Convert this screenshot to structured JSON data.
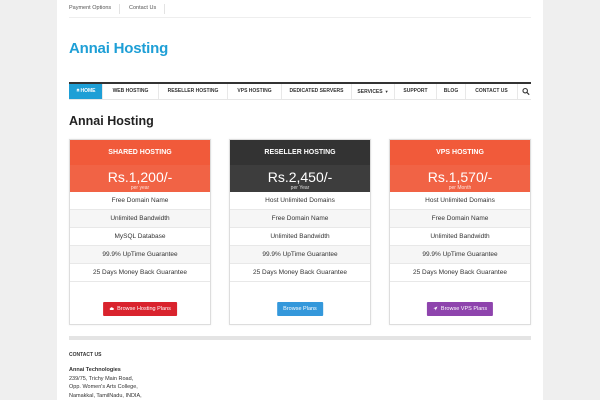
{
  "topbar": {
    "links": [
      "Payment Options",
      "Contact Us"
    ]
  },
  "site": {
    "title": "Annai Hosting"
  },
  "nav": {
    "items": [
      "HOME",
      "WEB HOSTING",
      "RESELLER HOSTING",
      "VPS HOSTING",
      "DEDICATED SERVERS",
      "SERVICES",
      "SUPPORT",
      "BLOG",
      "CONTACT US"
    ],
    "active": "HOME",
    "active_color": "#1e9fd6"
  },
  "page": {
    "title": "Annai Hosting"
  },
  "plans": [
    {
      "name": "SHARED HOSTING",
      "price": "Rs.1,200/-",
      "period": "per year",
      "color": "#f15a3a",
      "features": [
        "Free Domain Name",
        "Unlimited Bandwidth",
        "MySQL Database",
        "99.9% UpTime Guarantee",
        "25 Days Money Back Guarantee"
      ],
      "button": {
        "label": "Browse Hosting Plans",
        "color": "#d9232d",
        "icon": "cloud-icon"
      }
    },
    {
      "name": "RESELLER HOSTING",
      "price": "Rs.2,450/-",
      "period": "per Year",
      "color": "#333333",
      "features": [
        "Host Unlimited Domains",
        "Free Domain Name",
        "Unlimited Bandwidth",
        "99.9% UpTime Guarantee",
        "25 Days Money Back Guarantee"
      ],
      "button": {
        "label": "Browse Plans",
        "color": "#3498db",
        "icon": ""
      }
    },
    {
      "name": "VPS HOSTING",
      "price": "Rs.1,570/-",
      "period": "per Month",
      "color": "#f15a3a",
      "features": [
        "Host Unlimited Domains",
        "Free Domain Name",
        "Unlimited Bandwidth",
        "99.9% UpTime Guarantee",
        "25 Days Money Back Guarantee"
      ],
      "button": {
        "label": "Browse VPS Plans",
        "color": "#8e44ad",
        "icon": "rocket-icon"
      }
    }
  ],
  "contact": {
    "heading": "CONTACT US",
    "org": "Annai Technologies",
    "lines": [
      "239/75, Trichy Main Road,",
      "Opp. Women's Arts College,",
      "Namakkal, TamilNadu, INDIA,"
    ]
  }
}
